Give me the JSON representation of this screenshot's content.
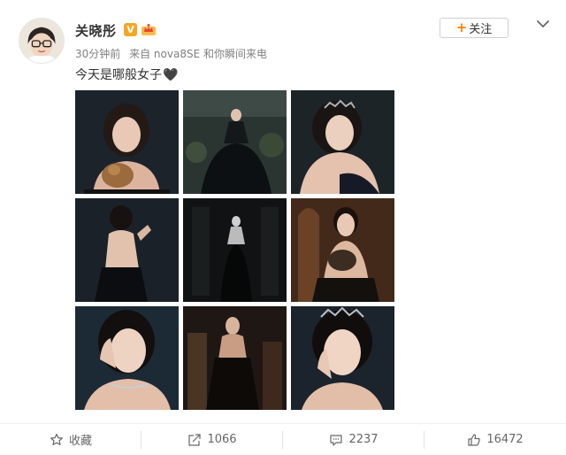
{
  "user": {
    "name": "关晓彤",
    "verified_badge": "V"
  },
  "meta": {
    "time": "30分钟前",
    "source": "来自 nova8SE 和你瞬间来电"
  },
  "follow": {
    "plus": "+",
    "label": "关注"
  },
  "post": {
    "text": "今天是哪般女子",
    "emoji": "🖤"
  },
  "photos": [
    {
      "name": "photo-portrait-with-cat"
    },
    {
      "name": "photo-sitting-in-black-gown"
    },
    {
      "name": "photo-portrait-with-tiara"
    },
    {
      "name": "photo-back-view-black-dress"
    },
    {
      "name": "photo-dark-hallway-figure"
    },
    {
      "name": "photo-holding-cat-throne"
    },
    {
      "name": "photo-hand-on-face-closeup"
    },
    {
      "name": "photo-standing-dark-room"
    },
    {
      "name": "photo-tiara-closeup"
    }
  ],
  "actions": {
    "favorite_label": "收藏",
    "repost_count": "1066",
    "comment_count": "2237",
    "like_count": "16472"
  },
  "colors": {
    "accent": "#ff8200",
    "verified": "#f5a623",
    "text": "#333333",
    "muted": "#808080"
  },
  "icons": [
    "chevron-down-icon",
    "star-icon",
    "share-icon",
    "comment-icon",
    "thumbs-up-icon",
    "crown-icon"
  ]
}
